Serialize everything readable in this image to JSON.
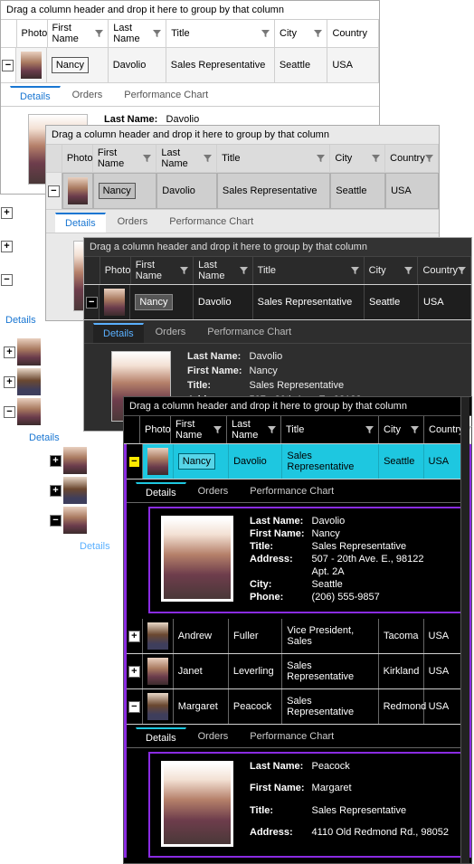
{
  "group_hint": "Drag a column header and drop it here to group by that column",
  "columns": {
    "photo": "Photo",
    "first": "First Name",
    "last": "Last Name",
    "title": "Title",
    "city": "City",
    "country": "Country"
  },
  "tabs": {
    "details": "Details",
    "orders": "Orders",
    "perf": "Performance Chart"
  },
  "labels": {
    "last": "Last Name:",
    "first": "First Name:",
    "title": "Title:",
    "address": "Address:",
    "city": "City:",
    "phone": "Phone:"
  },
  "emp": {
    "nancy": {
      "first": "Nancy",
      "last": "Davolio",
      "title": "Sales Representative",
      "city": "Seattle",
      "country": "USA",
      "addr_l1": "507 - 20th Ave. E., 98122",
      "addr_l2": "Apt. 2A",
      "phone": "(206) 555-9857"
    },
    "andrew": {
      "first": "Andrew",
      "last": "Fuller",
      "title": "Vice President, Sales",
      "city": "Tacoma",
      "country": "USA"
    },
    "janet": {
      "first": "Janet",
      "last": "Leverling",
      "title": "Sales Representative",
      "city": "Kirkland",
      "country": "USA"
    },
    "margaret": {
      "first": "Margaret",
      "last": "Peacock",
      "title": "Sales Representative",
      "city": "Redmond",
      "country": "USA",
      "address": "4110 Old Redmond Rd., 98052"
    }
  }
}
